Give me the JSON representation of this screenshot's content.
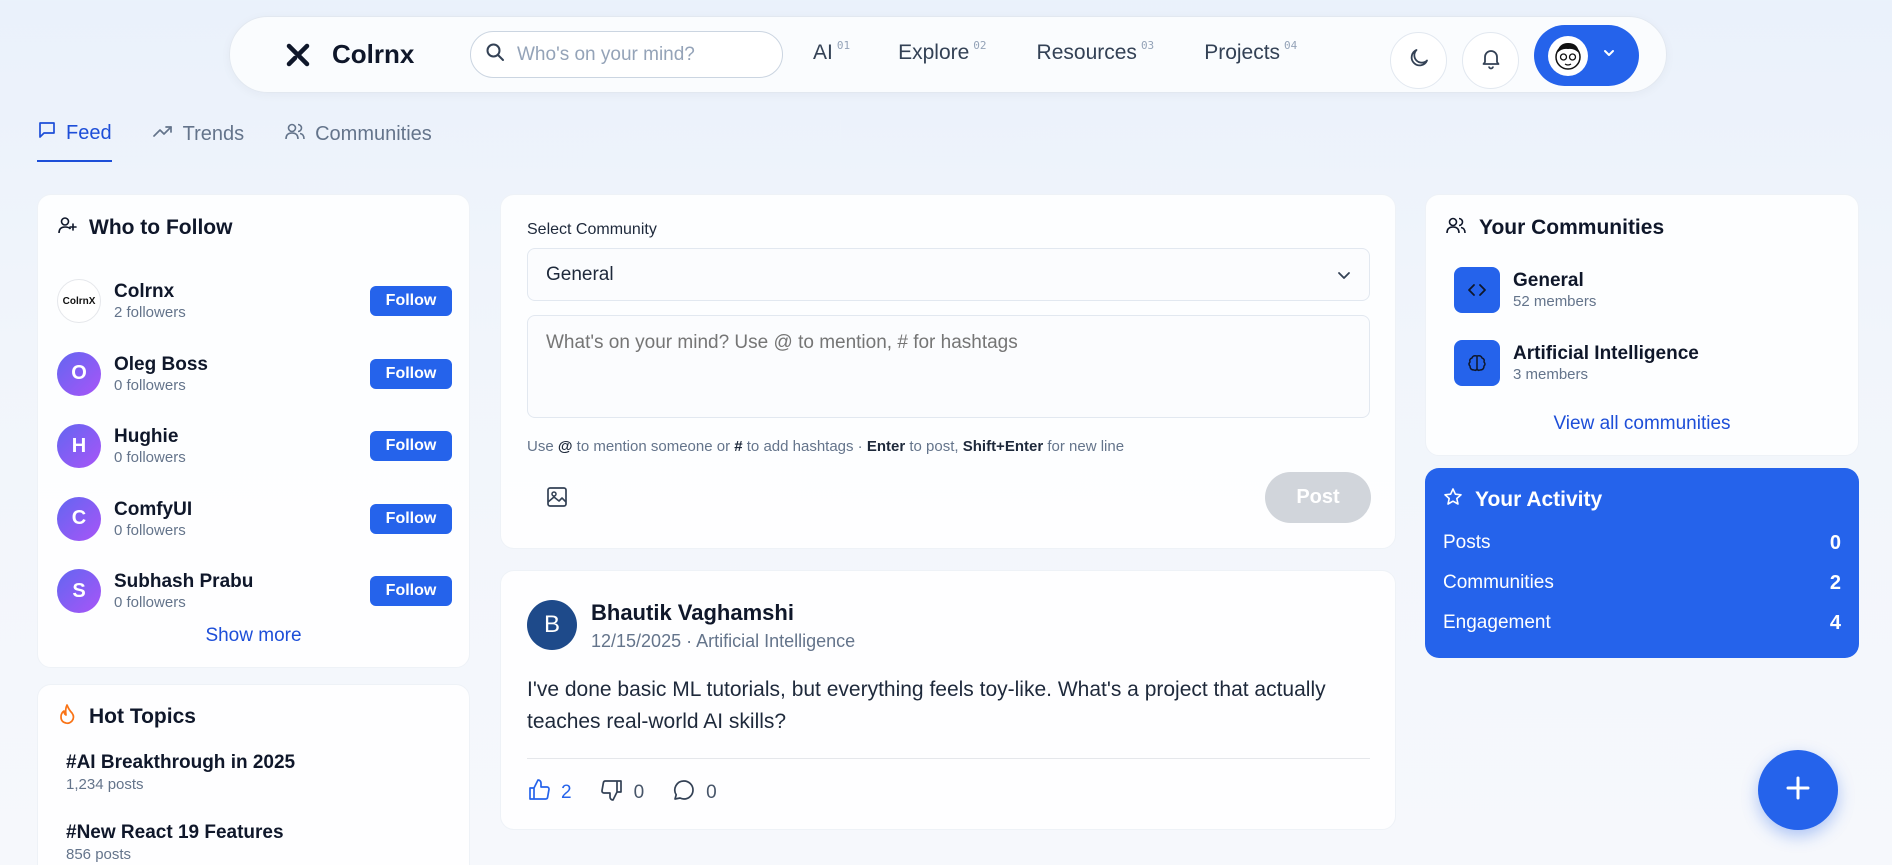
{
  "brand": {
    "name": "Colrnx"
  },
  "search": {
    "placeholder": "Who's on your mind?"
  },
  "nav": [
    {
      "label": "AI",
      "num": "01"
    },
    {
      "label": "Explore",
      "num": "02"
    },
    {
      "label": "Resources",
      "num": "03"
    },
    {
      "label": "Projects",
      "num": "04"
    }
  ],
  "tabs": [
    {
      "label": "Feed"
    },
    {
      "label": "Trends"
    },
    {
      "label": "Communities"
    }
  ],
  "who_to_follow": {
    "title": "Who to Follow",
    "follow_label": "Follow",
    "show_more": "Show more",
    "users": [
      {
        "name": "Colrnx",
        "sub": "2 followers",
        "initial": "ColrnX"
      },
      {
        "name": "Oleg Boss",
        "sub": "0 followers",
        "initial": "O"
      },
      {
        "name": "Hughie",
        "sub": "0 followers",
        "initial": "H"
      },
      {
        "name": "ComfyUI",
        "sub": "0 followers",
        "initial": "C"
      },
      {
        "name": "Subhash Prabu",
        "sub": "0 followers",
        "initial": "S"
      }
    ]
  },
  "hot_topics": {
    "title": "Hot Topics",
    "items": [
      {
        "name": "#AI Breakthrough in 2025",
        "sub": "1,234 posts"
      },
      {
        "name": "#New React 19 Features",
        "sub": "856 posts"
      }
    ]
  },
  "composer": {
    "select_label": "Select Community",
    "selected": "General",
    "placeholder": "What's on your mind? Use @ to mention, # for hashtags",
    "hint_1": "Use ",
    "hint_at": "@",
    "hint_2": " to mention someone or ",
    "hint_hash": "#",
    "hint_3": " to add hashtags · ",
    "hint_enter": "Enter",
    "hint_4": " to post, ",
    "hint_shift": "Shift+Enter",
    "hint_5": " for new line",
    "post_label": "Post"
  },
  "post": {
    "initial": "B",
    "author": "Bhautik Vaghamshi",
    "meta": "12/15/2025 · Artificial Intelligence",
    "body": "I've done basic ML tutorials, but everything feels toy-like. What's a project that actually teaches real-world AI skills?",
    "likes": "2",
    "dislikes": "0",
    "comments": "0"
  },
  "your_communities": {
    "title": "Your Communities",
    "view_all": "View all communities",
    "items": [
      {
        "name": "General",
        "sub": "52 members",
        "icon": "code-icon"
      },
      {
        "name": "Artificial Intelligence",
        "sub": "3 members",
        "icon": "brain-icon"
      }
    ]
  },
  "activity": {
    "title": "Your Activity",
    "rows": [
      {
        "label": "Posts",
        "value": "0"
      },
      {
        "label": "Communities",
        "value": "2"
      },
      {
        "label": "Engagement",
        "value": "4"
      }
    ]
  },
  "colors": {
    "accent": "#2563eb",
    "text": "#0f172a",
    "muted": "#64748b"
  }
}
